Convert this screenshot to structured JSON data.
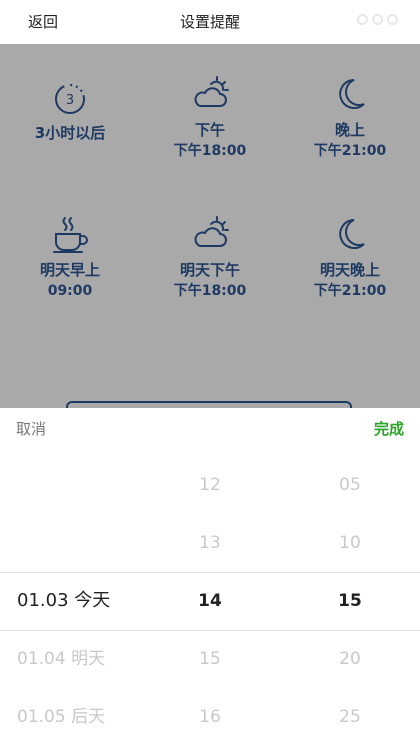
{
  "header": {
    "back_label": "返回",
    "title": "设置提醒"
  },
  "options": [
    {
      "icon": "clock-3-icon",
      "label": "3小时以后",
      "time": ""
    },
    {
      "icon": "partly-cloudy-icon",
      "label": "下午",
      "time": "下午18:00"
    },
    {
      "icon": "moon-icon",
      "label": "晚上",
      "time": "下午21:00"
    },
    {
      "icon": "coffee-cup-icon",
      "label": "明天早上",
      "time": "09:00"
    },
    {
      "icon": "partly-cloudy-icon",
      "label": "明天下午",
      "time": "下午18:00"
    },
    {
      "icon": "moon-icon",
      "label": "明天晚上",
      "time": "下午21:00"
    }
  ],
  "clock_icon_number": "3",
  "picker": {
    "cancel_label": "取消",
    "done_label": "完成",
    "dates": [
      "",
      "",
      "01.03  今天",
      "01.04  明天",
      "01.05  后天"
    ],
    "hours": [
      "12",
      "13",
      "14",
      "15",
      "16"
    ],
    "minutes": [
      "05",
      "10",
      "15",
      "20",
      "25"
    ],
    "selected_index": 2
  },
  "colors": {
    "accent_done": "#2aa52a",
    "icon_text": "#1e3a63",
    "overlay": "#a9a9a9"
  }
}
